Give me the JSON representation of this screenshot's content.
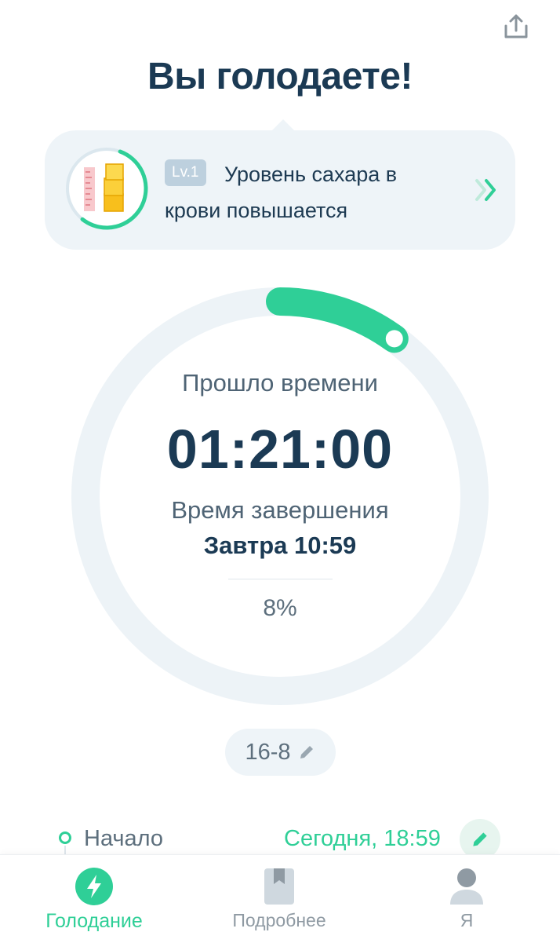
{
  "header": {
    "title": "Вы голодаете!",
    "share_icon": "share-icon"
  },
  "stage": {
    "level_badge": "Lv.1",
    "description": "Уровень сахара в крови повышается",
    "icon": "blood-sugar-icon",
    "arrow_icon": "chevron-double-right-icon",
    "ring_progress": 0.55
  },
  "timer": {
    "elapsed_label": "Прошло времени",
    "elapsed_value": "01:21:00",
    "end_label": "Время завершения",
    "end_value": "Завтра 10:59",
    "percent": "8%",
    "progress": 0.08
  },
  "plan": {
    "label": "16-8",
    "edit_icon": "pencil-icon"
  },
  "start": {
    "label": "Начало",
    "time": "Сегодня, 18:59",
    "edit_icon": "pencil-icon"
  },
  "tabs": [
    {
      "label": "Голодание",
      "icon": "lightning-icon",
      "active": true
    },
    {
      "label": "Подробнее",
      "icon": "book-icon",
      "active": false
    },
    {
      "label": "Я",
      "icon": "user-icon",
      "active": false
    }
  ],
  "colors": {
    "accent": "#2fcf97",
    "title": "#1b3a54",
    "card_bg": "#eef4f8",
    "track": "#edf3f7"
  }
}
